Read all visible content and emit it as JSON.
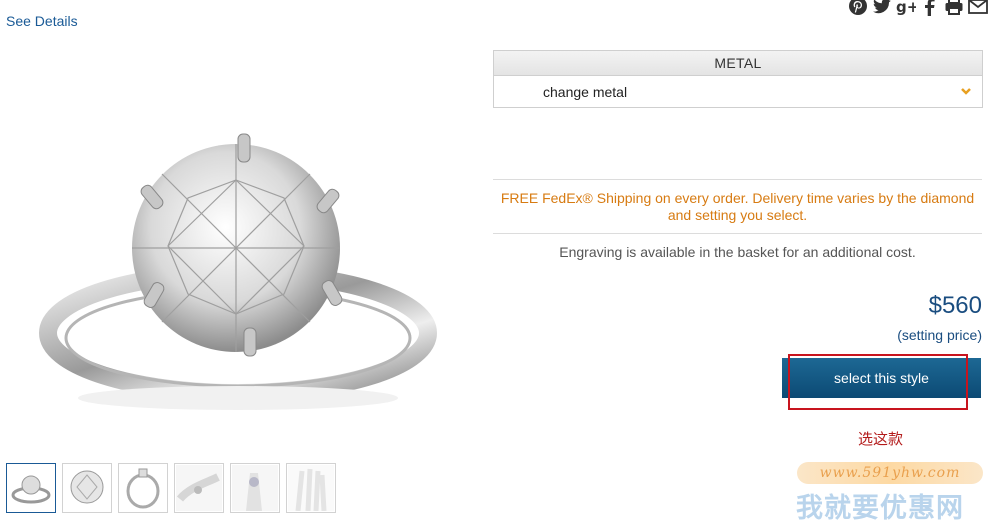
{
  "links": {
    "see_details": "See Details"
  },
  "share_icons": [
    "pinterest-icon",
    "twitter-icon",
    "google-plus-icon",
    "facebook-icon",
    "print-icon",
    "email-icon"
  ],
  "metal": {
    "header": "METAL",
    "value": "change metal"
  },
  "shipping_text": "FREE FedEx® Shipping on every order. Delivery time varies by the diamond and setting you select.",
  "engraving_text": "Engraving is available in the basket for an additional cost.",
  "price": {
    "amount": "$560",
    "note": "(setting price)"
  },
  "select_button": "select this style",
  "annotation": "选这款",
  "watermark": {
    "url": "www.591yhw.com",
    "name": "我就要优惠网"
  },
  "colors": {
    "link": "#1a5a96",
    "shipping": "#d77b12",
    "price": "#1a4d80",
    "button": "#0c4a74",
    "highlight": "#c8141e",
    "chevron": "#e8a020"
  }
}
